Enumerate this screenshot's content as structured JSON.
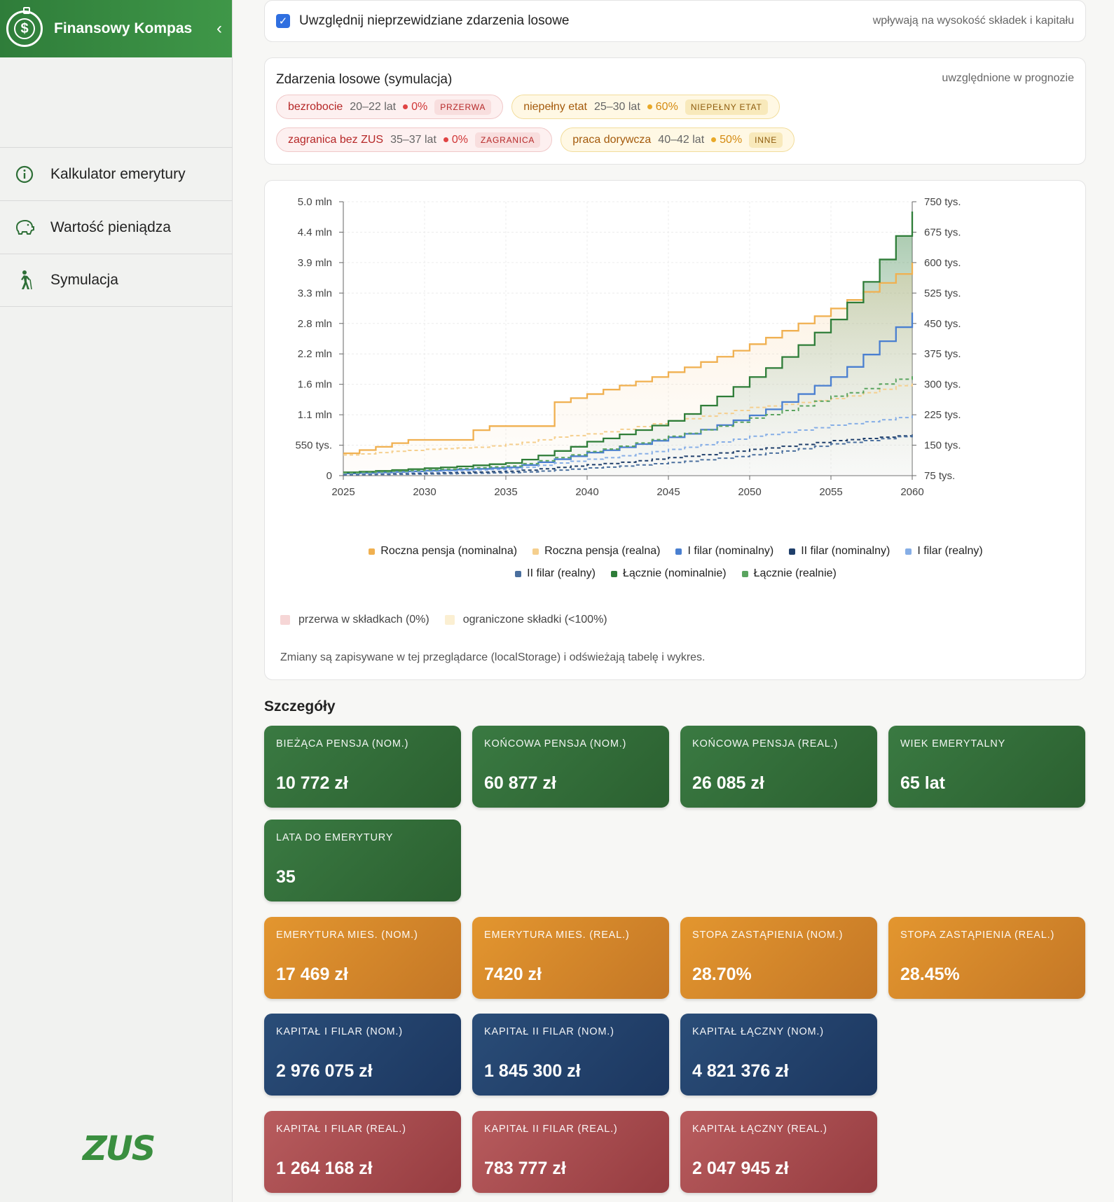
{
  "sidebar": {
    "brand": "Finansowy Kompas",
    "brand_icon": "compass-dollar-icon",
    "collapse_icon": "chevron-left-icon",
    "items": [
      {
        "label": "Kalkulator emerytury",
        "icon": "info-circle-icon"
      },
      {
        "label": "Wartość pieniądza",
        "icon": "piggy-bank-icon"
      },
      {
        "label": "Symulacja",
        "icon": "walking-person-icon"
      }
    ],
    "footer_logo": "ZUS"
  },
  "random_toggle": {
    "checked": true,
    "label": "Uwzględnij nieprzewidziane zdarzenia losowe",
    "note": "wpływają na wysokość składek i kapitału"
  },
  "events": {
    "title": "Zdarzenia losowe (symulacja)",
    "note": "uwzględnione w prognozie",
    "items": [
      {
        "name": "bezrobocie",
        "age": "20–22 lat",
        "pct": "0%",
        "tag": "PRZERWA",
        "kind": "red"
      },
      {
        "name": "niepełny etat",
        "age": "25–30 lat",
        "pct": "60%",
        "tag": "NIEPEŁNY ETAT",
        "kind": "yellow"
      },
      {
        "name": "zagranica bez ZUS",
        "age": "35–37 lat",
        "pct": "0%",
        "tag": "ZAGRANICA",
        "kind": "red"
      },
      {
        "name": "praca dorywcza",
        "age": "40–42 lat",
        "pct": "50%",
        "tag": "INNE",
        "kind": "yellow"
      }
    ]
  },
  "chart": {
    "shade_legend": [
      {
        "label": "przerwa w składkach (0%)",
        "color": "#f6d6d6"
      },
      {
        "label": "ograniczone składki (<100%)",
        "color": "#fbefd2"
      }
    ],
    "note": "Zmiany są zapisywane w tej przeglądarce (localStorage) i odświeżają tabelę i wykres."
  },
  "chart_data": {
    "type": "line",
    "x_ticks": [
      "2025",
      "2030",
      "2035",
      "2040",
      "2045",
      "2050",
      "2055",
      "2060"
    ],
    "xlim": [
      2025,
      2060
    ],
    "y_left_ticks": [
      "0",
      "550 tys.",
      "1.1 mln",
      "1.6 mln",
      "2.2 mln",
      "2.8 mln",
      "3.3 mln",
      "3.9 mln",
      "4.4 mln",
      "5.0 mln"
    ],
    "y_left_lim": [
      0,
      5000000
    ],
    "y_right_ticks": [
      "75 tys.",
      "150 tys.",
      "225 tys.",
      "300 tys.",
      "375 tys.",
      "450 tys.",
      "525 tys.",
      "600 tys.",
      "675 tys.",
      "750 tys."
    ],
    "y_right_lim": [
      75000,
      750000
    ],
    "series": [
      {
        "name": "Roczna pensja (nominalna)",
        "axis": "right",
        "color": "#f0b050",
        "dash": false,
        "points": [
          [
            2025,
            130000
          ],
          [
            2026,
            138000
          ],
          [
            2027,
            146000
          ],
          [
            2028,
            155000
          ],
          [
            2029,
            163000
          ],
          [
            2030,
            163000
          ],
          [
            2031,
            163000
          ],
          [
            2032,
            163000
          ],
          [
            2033,
            187000
          ],
          [
            2034,
            197000
          ],
          [
            2035,
            197000
          ],
          [
            2036,
            197000
          ],
          [
            2037,
            197000
          ],
          [
            2038,
            256000
          ],
          [
            2039,
            266000
          ],
          [
            2040,
            276000
          ],
          [
            2041,
            287000
          ],
          [
            2042,
            297000
          ],
          [
            2043,
            307000
          ],
          [
            2044,
            318000
          ],
          [
            2045,
            330000
          ],
          [
            2046,
            342000
          ],
          [
            2047,
            355000
          ],
          [
            2048,
            368000
          ],
          [
            2049,
            383000
          ],
          [
            2050,
            399000
          ],
          [
            2051,
            415000
          ],
          [
            2052,
            432000
          ],
          [
            2053,
            450000
          ],
          [
            2054,
            468000
          ],
          [
            2055,
            487000
          ],
          [
            2056,
            508000
          ],
          [
            2057,
            528000
          ],
          [
            2058,
            550000
          ],
          [
            2059,
            572000
          ],
          [
            2060,
            600000
          ]
        ]
      },
      {
        "name": "Roczna pensja (realna)",
        "axis": "right",
        "color": "#f5cf8e",
        "dash": true,
        "points": [
          [
            2025,
            126000
          ],
          [
            2028,
            135000
          ],
          [
            2030,
            140000
          ],
          [
            2033,
            145000
          ],
          [
            2035,
            152000
          ],
          [
            2038,
            170000
          ],
          [
            2040,
            178000
          ],
          [
            2045,
            210000
          ],
          [
            2050,
            243000
          ],
          [
            2055,
            265000
          ],
          [
            2060,
            306000
          ]
        ]
      },
      {
        "name": "I filar (nominalny)",
        "axis": "left",
        "color": "#4a7fd0",
        "dash": false,
        "points": [
          [
            2025,
            40000
          ],
          [
            2030,
            90000
          ],
          [
            2035,
            150000
          ],
          [
            2038,
            300000
          ],
          [
            2040,
            420000
          ],
          [
            2045,
            700000
          ],
          [
            2050,
            1100000
          ],
          [
            2055,
            1800000
          ],
          [
            2060,
            2976075
          ]
        ]
      },
      {
        "name": "II filar (nominalny)",
        "axis": "left",
        "color": "#1f3f6b",
        "dash": true,
        "points": [
          [
            2025,
            20000
          ],
          [
            2030,
            45000
          ],
          [
            2035,
            80000
          ],
          [
            2038,
            150000
          ],
          [
            2040,
            200000
          ],
          [
            2045,
            330000
          ],
          [
            2050,
            480000
          ],
          [
            2055,
            640000
          ],
          [
            2060,
            750000
          ]
        ]
      },
      {
        "name": "I filar (realny)",
        "axis": "left",
        "color": "#86aee6",
        "dash": true,
        "points": [
          [
            2025,
            35000
          ],
          [
            2030,
            75000
          ],
          [
            2035,
            120000
          ],
          [
            2038,
            230000
          ],
          [
            2040,
            300000
          ],
          [
            2045,
            480000
          ],
          [
            2050,
            720000
          ],
          [
            2055,
            920000
          ],
          [
            2060,
            1100000
          ]
        ]
      },
      {
        "name": "II filar (realny)",
        "axis": "left",
        "color": "#4a6f9e",
        "dash": true,
        "points": [
          [
            2025,
            15000
          ],
          [
            2030,
            30000
          ],
          [
            2035,
            55000
          ],
          [
            2038,
            100000
          ],
          [
            2040,
            140000
          ],
          [
            2045,
            240000
          ],
          [
            2050,
            380000
          ],
          [
            2055,
            580000
          ],
          [
            2060,
            750000
          ]
        ]
      },
      {
        "name": "Łącznie (nominalnie)",
        "axis": "left",
        "color": "#2e7d38",
        "dash": false,
        "points": [
          [
            2025,
            60000
          ],
          [
            2030,
            135000
          ],
          [
            2035,
            230000
          ],
          [
            2038,
            450000
          ],
          [
            2040,
            620000
          ],
          [
            2045,
            1000000
          ],
          [
            2050,
            1800000
          ],
          [
            2055,
            2850000
          ],
          [
            2060,
            4821376
          ]
        ]
      },
      {
        "name": "Łącznie (realnie)",
        "axis": "left",
        "color": "#5aa45f",
        "dash": true,
        "points": [
          [
            2025,
            50000
          ],
          [
            2030,
            105000
          ],
          [
            2035,
            175000
          ],
          [
            2038,
            330000
          ],
          [
            2040,
            440000
          ],
          [
            2045,
            720000
          ],
          [
            2050,
            1050000
          ],
          [
            2055,
            1450000
          ],
          [
            2060,
            1850000
          ]
        ]
      }
    ]
  },
  "details": {
    "title": "Szczegóły",
    "tiles": [
      {
        "label": "BIEŻĄCA PENSJA (NOM.)",
        "value": "10 772 zł",
        "color": "green"
      },
      {
        "label": "KOŃCOWA PENSJA (NOM.)",
        "value": "60 877 zł",
        "color": "green"
      },
      {
        "label": "KOŃCOWA PENSJA (REAL.)",
        "value": "26 085 zł",
        "color": "green"
      },
      {
        "label": "WIEK EMERYTALNY",
        "value": "65 lat",
        "color": "green"
      },
      {
        "label": "LATA DO EMERYTURY",
        "value": "35",
        "color": "green"
      },
      {
        "label": "EMERYTURA MIES. (NOM.)",
        "value": "17 469 zł",
        "color": "orange"
      },
      {
        "label": "EMERYTURA MIES. (REAL.)",
        "value": "7420 zł",
        "color": "orange"
      },
      {
        "label": "STOPA ZASTĄPIENIA (NOM.)",
        "value": "28.70%",
        "color": "orange"
      },
      {
        "label": "STOPA ZASTĄPIENIA (REAL.)",
        "value": "28.45%",
        "color": "orange"
      },
      {
        "label": "KAPITAŁ I FILAR (NOM.)",
        "value": "2 976 075 zł",
        "color": "blue"
      },
      {
        "label": "KAPITAŁ II FILAR (NOM.)",
        "value": "1 845 300 zł",
        "color": "blue"
      },
      {
        "label": "KAPITAŁ ŁĄCZNY (NOM.)",
        "value": "4 821 376 zł",
        "color": "blue"
      },
      {
        "label": "KAPITAŁ I FILAR (REAL.)",
        "value": "1 264 168 zł",
        "color": "red"
      },
      {
        "label": "KAPITAŁ II FILAR (REAL.)",
        "value": "783 777 zł",
        "color": "red"
      },
      {
        "label": "KAPITAŁ ŁĄCZNY (REAL.)",
        "value": "2 047 945 zł",
        "color": "red"
      }
    ]
  }
}
